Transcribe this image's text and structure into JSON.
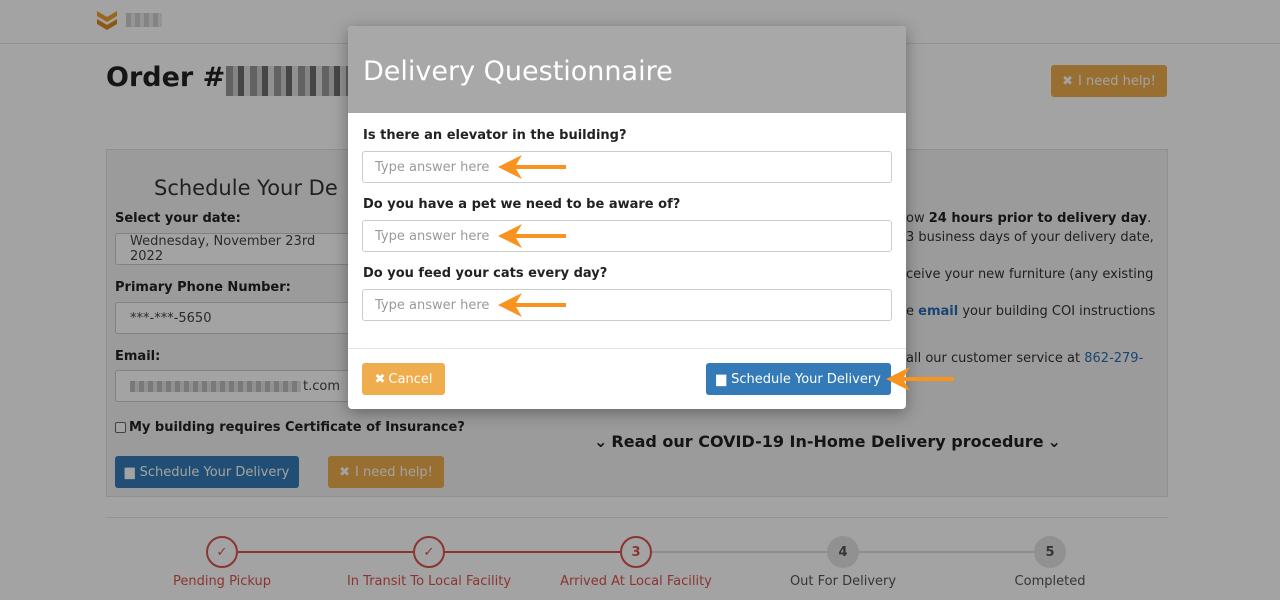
{
  "background": {
    "help_top_label": "I need help!",
    "schedule_heading": "Schedule Your De",
    "select_date_label": "Select your date:",
    "date_value": "Wednesday, November 23rd 2022",
    "phone_label": "Primary Phone Number:",
    "phone_value": "***-***-5650",
    "email_label": "Email:",
    "email_suffix": "t.com",
    "coi_label": "My building requires Certificate of Insurance?",
    "schedule_button_label": "Schedule Your Delivery",
    "help_button_label": "I need help!",
    "order_prefix": "Order #",
    "info_lines": {
      "l1_pre": "ow ",
      "l1_bold": "24 hours prior to delivery day",
      "l1_post": ".",
      "l2": "3 business days of your delivery date,",
      "l3": "ceive your new furniture (any existing",
      "l4_pre": "e ",
      "l4_link": "email",
      "l4_post": " your building COI instructions",
      "l5_pre": "all our customer service at ",
      "l5_link": "862-279-"
    },
    "covid_link": "Read our COVID-19 In-Home Delivery procedure"
  },
  "tracker": [
    {
      "step": "✓",
      "label": "Pending Pickup",
      "status": "done"
    },
    {
      "step": "✓",
      "label": "In Transit To Local Facility",
      "status": "done"
    },
    {
      "step": "3",
      "label": "Arrived At Local Facility",
      "status": "current"
    },
    {
      "step": "4",
      "label": "Out For Delivery",
      "status": "todo"
    },
    {
      "step": "5",
      "label": "Completed",
      "status": "todo"
    }
  ],
  "modal": {
    "title": "Delivery Questionnaire",
    "questions": [
      {
        "label": "Is there an elevator in the building?",
        "placeholder": "Type answer here",
        "value": ""
      },
      {
        "label": "Do you have a pet we need to be aware of?",
        "placeholder": "Type answer here",
        "value": ""
      },
      {
        "label": "Do you feed your cats every day?",
        "placeholder": "Type answer here",
        "value": ""
      }
    ],
    "cancel_label": "Cancel",
    "schedule_label": "Schedule Your Delivery"
  },
  "colors": {
    "accent_orange": "#f0ad4e",
    "primary_blue": "#337ab7",
    "tracker_red": "#d9534f",
    "annotation_arrow": "#f7931e"
  }
}
